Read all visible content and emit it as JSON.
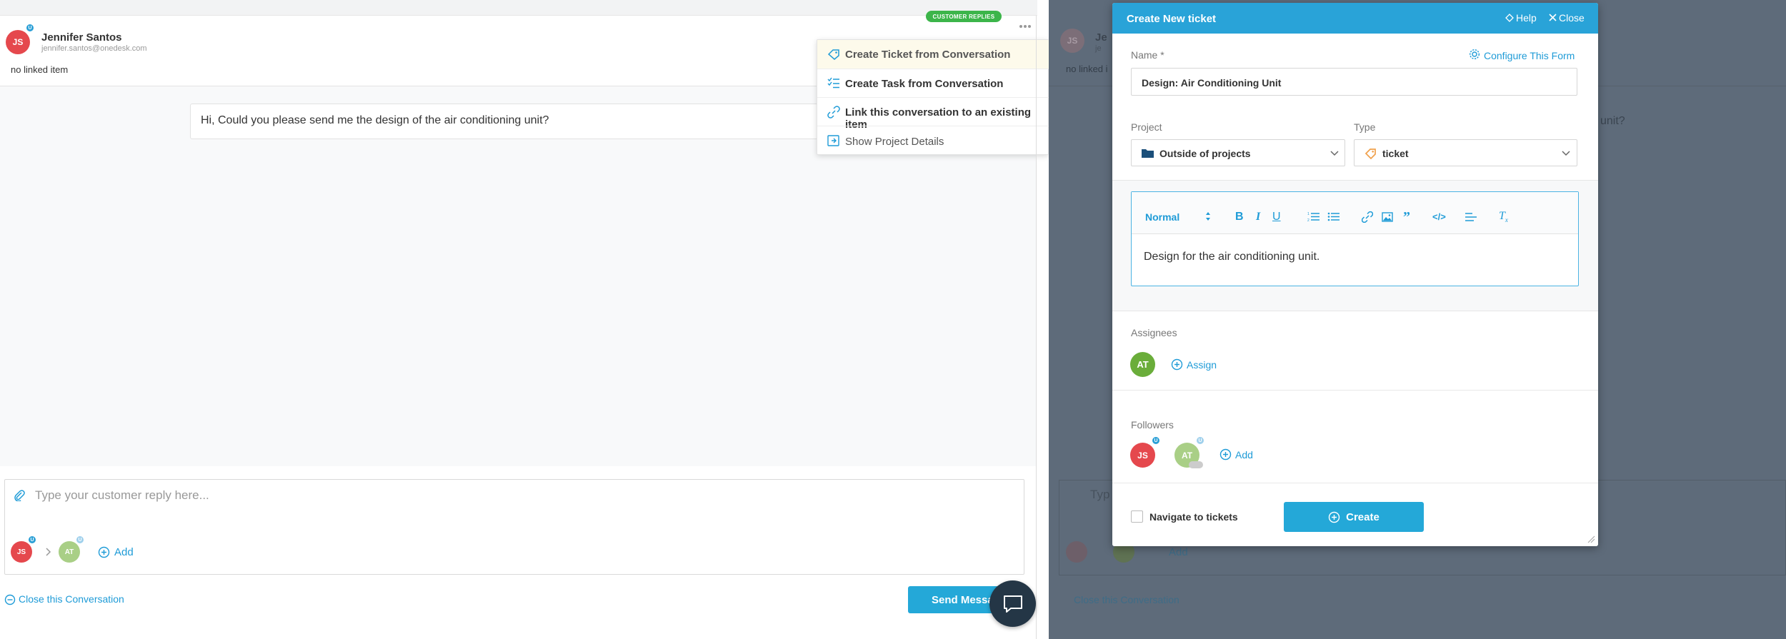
{
  "conversation": {
    "customer_badge": "CUSTOMER REPLIES",
    "more_icon": "ellipsis-icon",
    "customer": {
      "initials": "JS",
      "badge": "U",
      "name": "Jennifer Santos",
      "email": "jennifer.santos@onedesk.com"
    },
    "linked_item": "no linked item",
    "message": "Hi, Could you please send me the design of the air conditioning unit?",
    "menu": [
      {
        "icon": "ticket-icon",
        "label": "Create Ticket from Conversation"
      },
      {
        "icon": "task-list-icon",
        "label": "Create Task from Conversation"
      },
      {
        "icon": "link-icon",
        "label": "Link this conversation to an existing item"
      },
      {
        "icon": "external-icon",
        "label": "Show Project Details"
      }
    ],
    "reply_placeholder": "Type your customer reply here...",
    "reply_participants": {
      "from_initials": "JS",
      "from_badge": "U",
      "to_initials": "AT",
      "to_badge": "U",
      "add_label": "Add"
    },
    "close_label": "Close this Conversation",
    "send_label": "Send Message",
    "chat_icon": "chat-bubble-icon"
  },
  "backdrop": {
    "avatar_initials": "JS",
    "name_fragment": "Je",
    "email_fragment": "je",
    "linked_item": "no linked i",
    "message_fragment": "unit?",
    "reply_fragment": "Typ",
    "add_label": "Add",
    "close_label": "Close this Conversation"
  },
  "modal": {
    "title": "Create New ticket",
    "help_label": "Help",
    "close_label": "Close",
    "name_label": "Name *",
    "configure_label": "Configure This Form",
    "name_value": "Design: Air Conditioning Unit",
    "project_label": "Project",
    "project_value": "Outside of projects",
    "type_label": "Type",
    "type_value": "ticket",
    "format_select": "Normal",
    "toolbar": [
      "bold-icon",
      "italic-icon",
      "underline-icon",
      "ordered-list-icon",
      "bullet-list-icon",
      "link-icon",
      "image-icon",
      "quote-icon",
      "code-icon",
      "align-icon",
      "clear-format-icon"
    ],
    "description": "Design for the air conditioning unit.",
    "assignees_label": "Assignees",
    "assignee_initials": "AT",
    "assign_label": "Assign",
    "followers_label": "Followers",
    "followers": [
      {
        "initials": "JS",
        "badge": "U",
        "color": "#e5484d"
      },
      {
        "initials": "AT",
        "badge": "U",
        "color": "#a9cf86"
      }
    ],
    "add_follower_label": "Add",
    "navigate_label": "Navigate to tickets",
    "create_label": "Create"
  },
  "colors": {
    "accent": "#24a8d8",
    "header_bg": "#29a3d8",
    "badge_green": "#3cb54a",
    "overlay": "#5e6b7a"
  }
}
